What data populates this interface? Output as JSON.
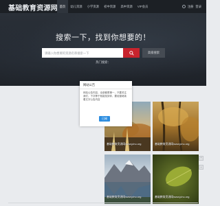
{
  "header": {
    "logo_text": "基础教育资源网",
    "nav": [
      {
        "label": "首页",
        "active": true
      },
      {
        "label": "幼儿资源",
        "active": false
      },
      {
        "label": "小学资源",
        "active": false
      },
      {
        "label": "初中资源",
        "active": false
      },
      {
        "label": "高中资源",
        "active": false
      },
      {
        "label": "VIP会员",
        "active": false
      }
    ],
    "register_label": "注册",
    "login_label": "登录"
  },
  "hero": {
    "title": "搜索一下，找到你想要的！",
    "search_placeholder": "请输入你想要的资源名称搜索一下",
    "advanced_search_label": "高级搜索",
    "hot_label": "热门搜索："
  },
  "modal": {
    "title": "网站公告",
    "body": "网站公告内容，全部都是第一，只要关注我们，下次等于就能找到你，要经营继续着文字公告内容",
    "ok_label": "已阅"
  },
  "cards": [
    {
      "caption": "基础教育资源网www.jchu.org"
    },
    {
      "caption": "基础教育资源网www.jchu.org"
    },
    {
      "caption": "基础教育资源网www.jchu.org"
    },
    {
      "caption": "基础教育资源网www.jchu.org"
    }
  ],
  "colors": {
    "topbar": "#1c2025",
    "search_button": "#c8242d",
    "ok_button": "#2c8de0"
  }
}
